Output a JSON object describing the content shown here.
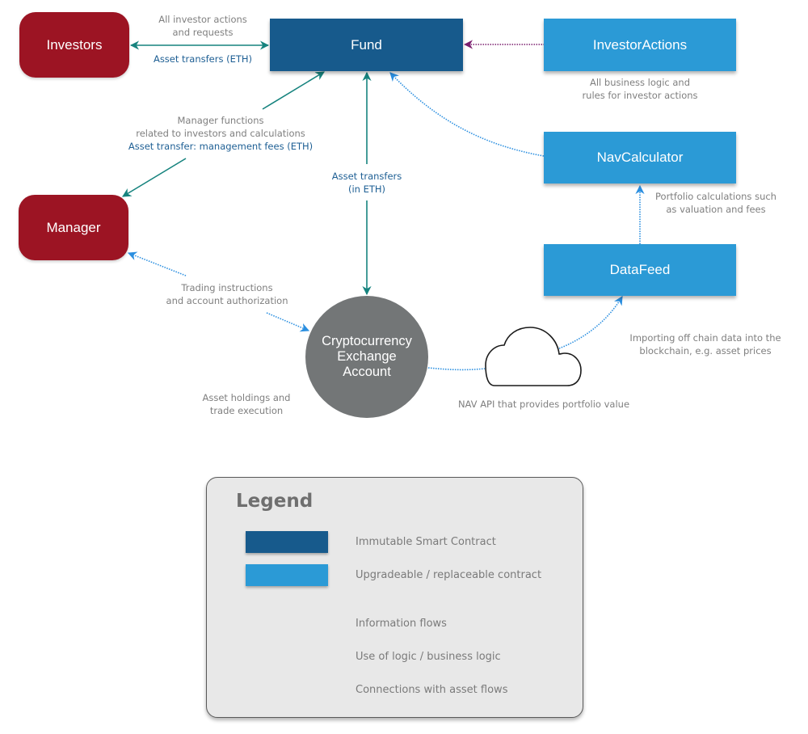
{
  "diagram": {
    "nodes": {
      "investors": {
        "label": "Investors",
        "kind": "actor"
      },
      "manager": {
        "label": "Manager",
        "kind": "actor"
      },
      "fund": {
        "label": "Fund",
        "kind": "immutable-contract"
      },
      "investor_actions": {
        "label": "InvestorActions",
        "kind": "upgradeable-contract"
      },
      "nav_calculator": {
        "label": "NavCalculator",
        "kind": "upgradeable-contract"
      },
      "data_feed": {
        "label": "DataFeed",
        "kind": "upgradeable-contract"
      },
      "exchange": {
        "lines": [
          "Cryptocurrency",
          "Exchange",
          "Account"
        ],
        "kind": "external-account"
      },
      "nav_api": {
        "label": "NAV API that provides portfolio value",
        "kind": "cloud-service",
        "icon": "cloud-icon"
      }
    },
    "annotations": {
      "investors_fund_info": [
        "All investor actions",
        "and requests"
      ],
      "investors_fund_asset": "Asset transfers (ETH)",
      "investor_actions_desc": [
        "All business logic and",
        "rules for investor actions"
      ],
      "manager_fund_info": [
        "Manager functions",
        "related to investors and calculations"
      ],
      "manager_fund_asset": "Asset transfer: management fees (ETH)",
      "fund_exchange_asset": [
        "Asset transfers",
        "(in ETH)"
      ],
      "nav_calc_desc": [
        "Portfolio calculations such",
        "as valuation and fees"
      ],
      "manager_exchange_info": [
        "Trading instructions",
        "and account authorization"
      ],
      "exchange_desc": [
        "Asset holdings and",
        "trade execution"
      ],
      "data_feed_desc": [
        "Importing off chain data into the",
        "blockchain, e.g. asset prices"
      ]
    },
    "edges": [
      {
        "from": "investors",
        "to": "fund",
        "type": "asset-flow",
        "direction": "both"
      },
      {
        "from": "investor_actions",
        "to": "fund",
        "type": "business-logic",
        "direction": "to"
      },
      {
        "from": "manager",
        "to": "fund",
        "type": "asset-flow",
        "direction": "both"
      },
      {
        "from": "exchange",
        "to": "fund",
        "type": "asset-flow",
        "direction": "both"
      },
      {
        "from": "nav_calculator",
        "to": "fund",
        "type": "information-flow",
        "direction": "to"
      },
      {
        "from": "data_feed",
        "to": "nav_calculator",
        "type": "information-flow",
        "direction": "to"
      },
      {
        "from": "manager",
        "to": "exchange",
        "type": "information-flow",
        "direction": "both"
      },
      {
        "from": "exchange",
        "to": "nav_api",
        "type": "information-flow",
        "direction": "none"
      },
      {
        "from": "nav_api",
        "to": "data_feed",
        "type": "information-flow",
        "direction": "to"
      }
    ]
  },
  "legend": {
    "title": "Legend",
    "items": [
      {
        "label": "Immutable Smart Contract",
        "kind": "swatch",
        "color": "#175a8c"
      },
      {
        "label": "Upgradeable / replaceable contract",
        "kind": "swatch",
        "color": "#2b9ad6"
      },
      {
        "label": "Information flows",
        "kind": "dotted-arrow",
        "color": "#2b9ad6"
      },
      {
        "label": "Use of logic / business logic",
        "kind": "dotted-arrow",
        "color": "#8a1c6b"
      },
      {
        "label": "Connections with asset flows",
        "kind": "solid-arrow",
        "color": "#16706f"
      }
    ]
  },
  "colors": {
    "actor": "#9c1423",
    "immutable": "#175a8c",
    "upgradeable": "#2b9ad6",
    "exchange": "#737677",
    "asset_flow": "#16837e",
    "information_flow": "#2b8fe0",
    "business_logic": "#7a1f6e",
    "label_gray": "#7f7f7f",
    "label_blue": "#1e5f94"
  }
}
